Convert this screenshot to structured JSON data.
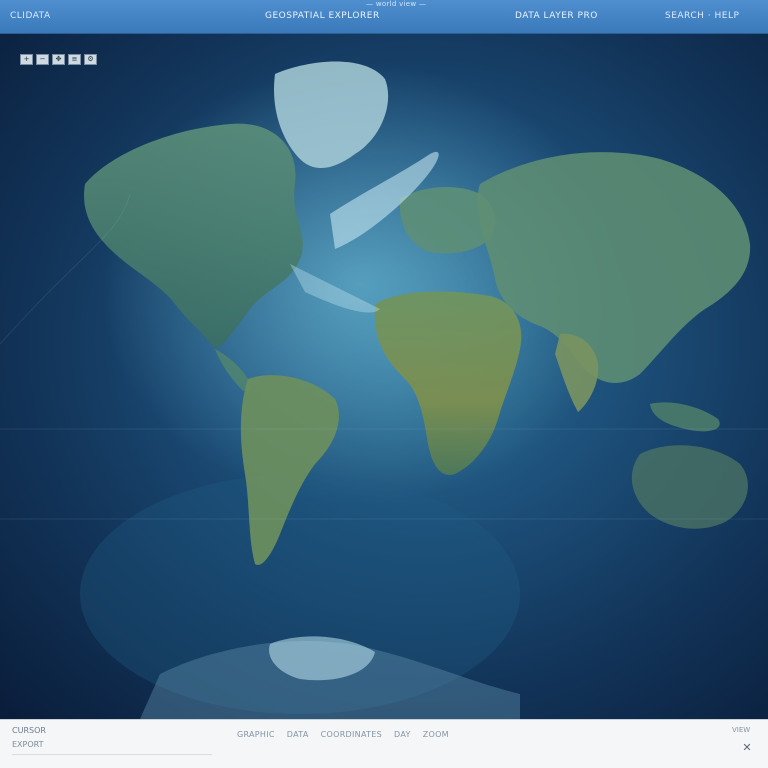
{
  "topbar": {
    "left_title": "CLIDATA",
    "center_title": "GEOSPATIAL EXPLORER",
    "center_sub": "— world view —",
    "right_title": "DATA LAYER PRO",
    "far_right": "SEARCH · HELP"
  },
  "map": {
    "toolbar_icons": [
      "zoom-in-icon",
      "zoom-out-icon",
      "pan-icon",
      "layers-icon",
      "settings-icon"
    ],
    "toolbar_glyphs": [
      "+",
      "−",
      "✥",
      "≡",
      "⚙"
    ],
    "colors": {
      "ocean_deep": "#0a1d3a",
      "ocean_mid": "#1c4e78",
      "ocean_light": "#2b6f95",
      "land": "#3f7d6a",
      "land_highlight": "#6e9a6f",
      "ice": "#bfe6f0"
    }
  },
  "bottombar": {
    "coord_label": "CURSOR",
    "coord_value": "EXPORT",
    "status_items": [
      "GRAPHIC",
      "DATA",
      "COORDINATES",
      "DAY",
      "ZOOM"
    ],
    "right_label": "VIEW",
    "close_glyph": "✕"
  }
}
